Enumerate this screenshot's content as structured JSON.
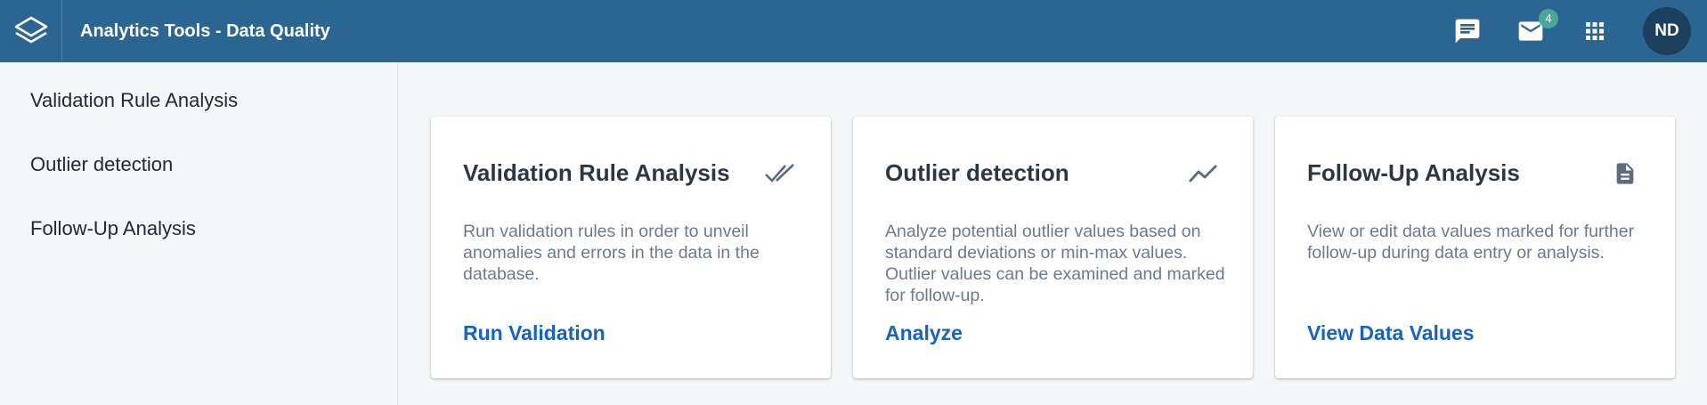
{
  "header": {
    "title": "Analytics Tools - Data Quality",
    "logo_icon": "dhis2-logo-icon",
    "icons": [
      "chat-icon",
      "mail-icon",
      "apps-grid-icon"
    ],
    "mail_badge": "4",
    "avatar_initials": "ND",
    "colors": {
      "bar": "#2b6692",
      "badge": "#48a999",
      "avatar": "#1d3f5e"
    }
  },
  "sidebar": {
    "items": [
      {
        "label": "Validation Rule Analysis"
      },
      {
        "label": "Outlier detection"
      },
      {
        "label": "Follow-Up Analysis"
      }
    ]
  },
  "cards": [
    {
      "title": "Validation Rule Analysis",
      "icon": "double-check-icon",
      "description": "Run validation rules in order to unveil anomalies and errors in the data in the database.",
      "action": "Run Validation"
    },
    {
      "title": "Outlier detection",
      "icon": "trending-line-icon",
      "description": "Analyze potential outlier values based on standard deviations or min-max values. Outlier values can be examined and marked for follow-up.",
      "action": "Analyze"
    },
    {
      "title": "Follow-Up Analysis",
      "icon": "document-icon",
      "description": "View or edit data values marked for further follow-up during data entry or analysis.",
      "action": "View Data Values"
    }
  ],
  "colors": {
    "link": "#1565c0",
    "background": "#f4f6f8"
  }
}
